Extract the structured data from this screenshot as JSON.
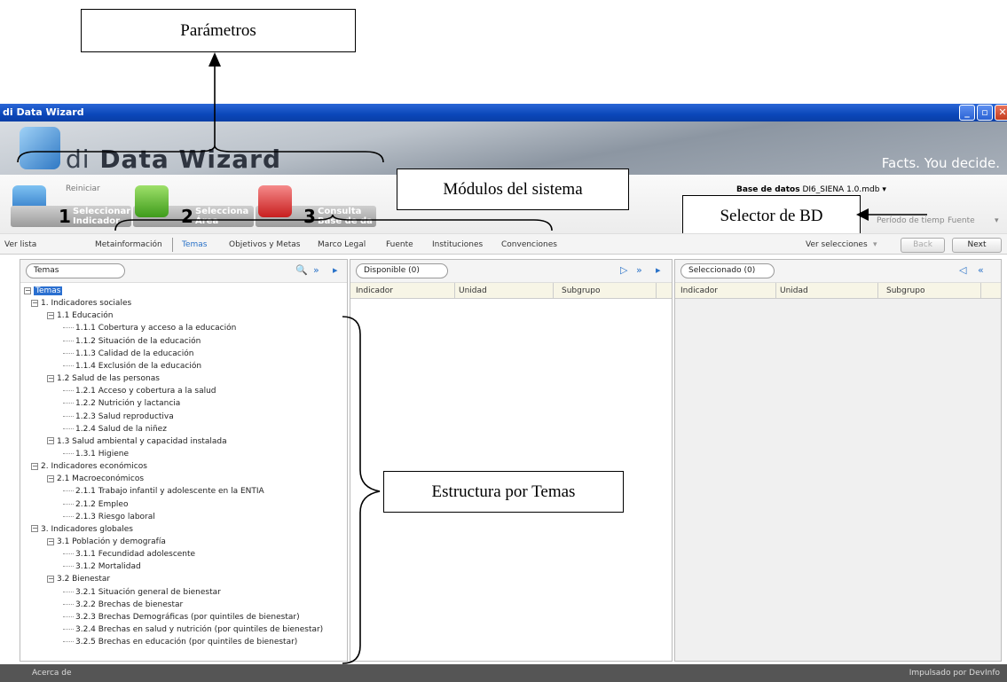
{
  "annotations": {
    "parametros": "Parámetros",
    "modulos": "Módulos del sistema",
    "selector_bd": "Selector de BD",
    "estructura": "Estructura por Temas"
  },
  "window": {
    "title": "di Data Wizard"
  },
  "banner": {
    "logo_prefix": "di",
    "logo_name": "Data Wizard",
    "slogan": "Facts. You decide."
  },
  "modules": {
    "reiniciar": "Reiniciar",
    "items": [
      {
        "number": "1",
        "label": "Seleccionar Indicador"
      },
      {
        "number": "2",
        "label": "Selecciona Área"
      },
      {
        "number": "3",
        "label": "Consulta Base de da"
      }
    ]
  },
  "database": {
    "label": "Base de datos",
    "value": "DI6_SIENA 1.0.mdb"
  },
  "filters": {
    "periodo": "Período de tiemp",
    "fuente": "Fuente"
  },
  "nav": {
    "items": [
      "Ver lista",
      "Metainformación",
      "Temas",
      "Objetivos y Metas",
      "Marco Legal",
      "Fuente",
      "Instituciones",
      "Convenciones"
    ],
    "active": "Temas",
    "ver_selecciones": "Ver selecciones",
    "back": "Back",
    "next": "Next"
  },
  "left_panel": {
    "dropdown": "Temas"
  },
  "tree": [
    {
      "level": 0,
      "label": "Temas",
      "expandable": true,
      "selected": true
    },
    {
      "level": 1,
      "label": "1. Indicadores sociales",
      "expandable": true
    },
    {
      "level": 2,
      "label": "1.1 Educación",
      "expandable": true
    },
    {
      "level": 3,
      "label": "1.1.1 Cobertura y acceso a la educación"
    },
    {
      "level": 3,
      "label": "1.1.2 Situación de la educación"
    },
    {
      "level": 3,
      "label": "1.1.3 Calidad de la educación"
    },
    {
      "level": 3,
      "label": "1.1.4 Exclusión de la educación"
    },
    {
      "level": 2,
      "label": "1.2 Salud de las personas",
      "expandable": true
    },
    {
      "level": 3,
      "label": "1.2.1 Acceso y cobertura a la salud"
    },
    {
      "level": 3,
      "label": "1.2.2 Nutrición y lactancia"
    },
    {
      "level": 3,
      "label": "1.2.3 Salud reproductiva"
    },
    {
      "level": 3,
      "label": "1.2.4 Salud de la niñez"
    },
    {
      "level": 2,
      "label": "1.3 Salud ambiental y capacidad instalada",
      "expandable": true
    },
    {
      "level": 3,
      "label": "1.3.1 Higiene"
    },
    {
      "level": 1,
      "label": "2. Indicadores económicos",
      "expandable": true
    },
    {
      "level": 2,
      "label": "2.1 Macroeconómicos",
      "expandable": true
    },
    {
      "level": 3,
      "label": "2.1.1 Trabajo infantil y adolescente en la ENTIA"
    },
    {
      "level": 3,
      "label": "2.1.2 Empleo"
    },
    {
      "level": 3,
      "label": "2.1.3 Riesgo laboral"
    },
    {
      "level": 1,
      "label": "3. Indicadores globales",
      "expandable": true
    },
    {
      "level": 2,
      "label": "3.1 Población y demografía",
      "expandable": true
    },
    {
      "level": 3,
      "label": "3.1.1 Fecundidad adolescente"
    },
    {
      "level": 3,
      "label": "3.1.2 Mortalidad"
    },
    {
      "level": 2,
      "label": "3.2 Bienestar",
      "expandable": true
    },
    {
      "level": 3,
      "label": "3.2.1 Situación general de bienestar"
    },
    {
      "level": 3,
      "label": "3.2.2 Brechas de bienestar"
    },
    {
      "level": 3,
      "label": "3.2.3 Brechas Demográficas (por quintiles de bienestar)"
    },
    {
      "level": 3,
      "label": "3.2.4 Brechas en salud y nutrición (por quintiles de bienestar)"
    },
    {
      "level": 3,
      "label": "3.2.5 Brechas en educación (por quintiles de bienestar)"
    }
  ],
  "middle_panel": {
    "title": "Disponible (0)",
    "columns": [
      "Indicador",
      "Unidad",
      "Subgrupo"
    ]
  },
  "right_panel": {
    "title": "Seleccionado (0)",
    "columns": [
      "Indicador",
      "Unidad",
      "Subgrupo"
    ]
  },
  "status": {
    "left": "Acerca de",
    "right": "Impulsado por DevInfo"
  },
  "colors": {
    "titlebar": "#0b47b9",
    "accent": "#2a72c8",
    "selection": "#2a6fd0"
  }
}
